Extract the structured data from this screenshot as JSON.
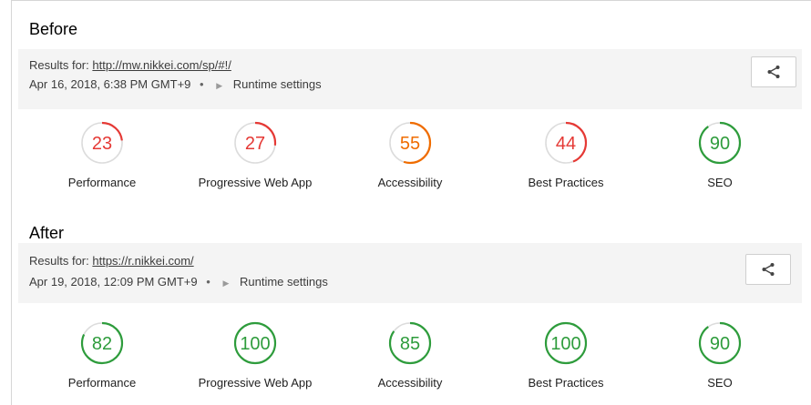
{
  "colors": {
    "fail": "#e53935",
    "average": "#ef6c00",
    "pass": "#2e9c3c",
    "track": "#dcdcdc"
  },
  "before": {
    "title": "Before",
    "results_prefix": "Results for:",
    "url": "http://mw.nikkei.com/sp/#!/",
    "date": "Apr 16, 2018, 6:38 PM GMT+9",
    "dot": "•",
    "runtime_label": "Runtime settings",
    "share_icon": "share-icon",
    "gauges": [
      {
        "score": 23,
        "label": "Performance",
        "status": "fail"
      },
      {
        "score": 27,
        "label": "Progressive Web App",
        "status": "fail"
      },
      {
        "score": 55,
        "label": "Accessibility",
        "status": "average"
      },
      {
        "score": 44,
        "label": "Best Practices",
        "status": "fail"
      },
      {
        "score": 90,
        "label": "SEO",
        "status": "pass"
      }
    ]
  },
  "after": {
    "title": "After",
    "results_prefix": "Results for:",
    "url": "https://r.nikkei.com/",
    "date": "Apr 19, 2018, 12:09 PM GMT+9",
    "dot": "•",
    "runtime_label": "Runtime settings",
    "share_icon": "share-icon",
    "gauges": [
      {
        "score": 82,
        "label": "Performance",
        "status": "pass"
      },
      {
        "score": 100,
        "label": "Progressive Web App",
        "status": "pass"
      },
      {
        "score": 85,
        "label": "Accessibility",
        "status": "pass"
      },
      {
        "score": 100,
        "label": "Best Practices",
        "status": "pass"
      },
      {
        "score": 90,
        "label": "SEO",
        "status": "pass"
      }
    ]
  }
}
